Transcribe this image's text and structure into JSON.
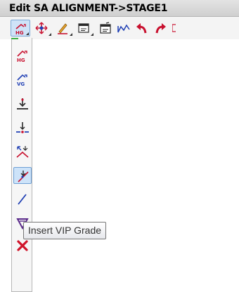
{
  "window": {
    "title": "Edit SA ALIGNMENT->STAGE1"
  },
  "toolbar": {
    "buttons": [
      {
        "name": "hg-grade-icon",
        "active": true,
        "has_dropdown": true
      },
      {
        "name": "move-icon",
        "has_dropdown": true
      },
      {
        "name": "pencil-icon",
        "has_dropdown": true
      },
      {
        "name": "window-icon",
        "has_dropdown": true
      },
      {
        "name": "window-edit-icon",
        "has_dropdown": false
      },
      {
        "name": "curve-icon",
        "has_dropdown": false
      },
      {
        "name": "undo-arrow-icon",
        "has_dropdown": false
      },
      {
        "name": "redo-arrow-icon",
        "has_dropdown": false
      }
    ]
  },
  "flyout": {
    "items": [
      {
        "name": "hg-icon",
        "label": "HG"
      },
      {
        "name": "vg-icon",
        "label": "VG"
      },
      {
        "name": "add-pvi-icon"
      },
      {
        "name": "insert-pvi-icon"
      },
      {
        "name": "delete-pvi-icon"
      },
      {
        "name": "insert-vip-grade-icon",
        "active": true
      },
      {
        "name": "grade-line-icon"
      },
      {
        "name": "filter-icon"
      },
      {
        "name": "delete-x-icon"
      }
    ]
  },
  "tooltip": {
    "text": "Insert VIP Grade"
  },
  "colors": {
    "accent_red": "#c8102e",
    "accent_blue": "#1f3fb4",
    "active_bg": "#cde3f9"
  }
}
